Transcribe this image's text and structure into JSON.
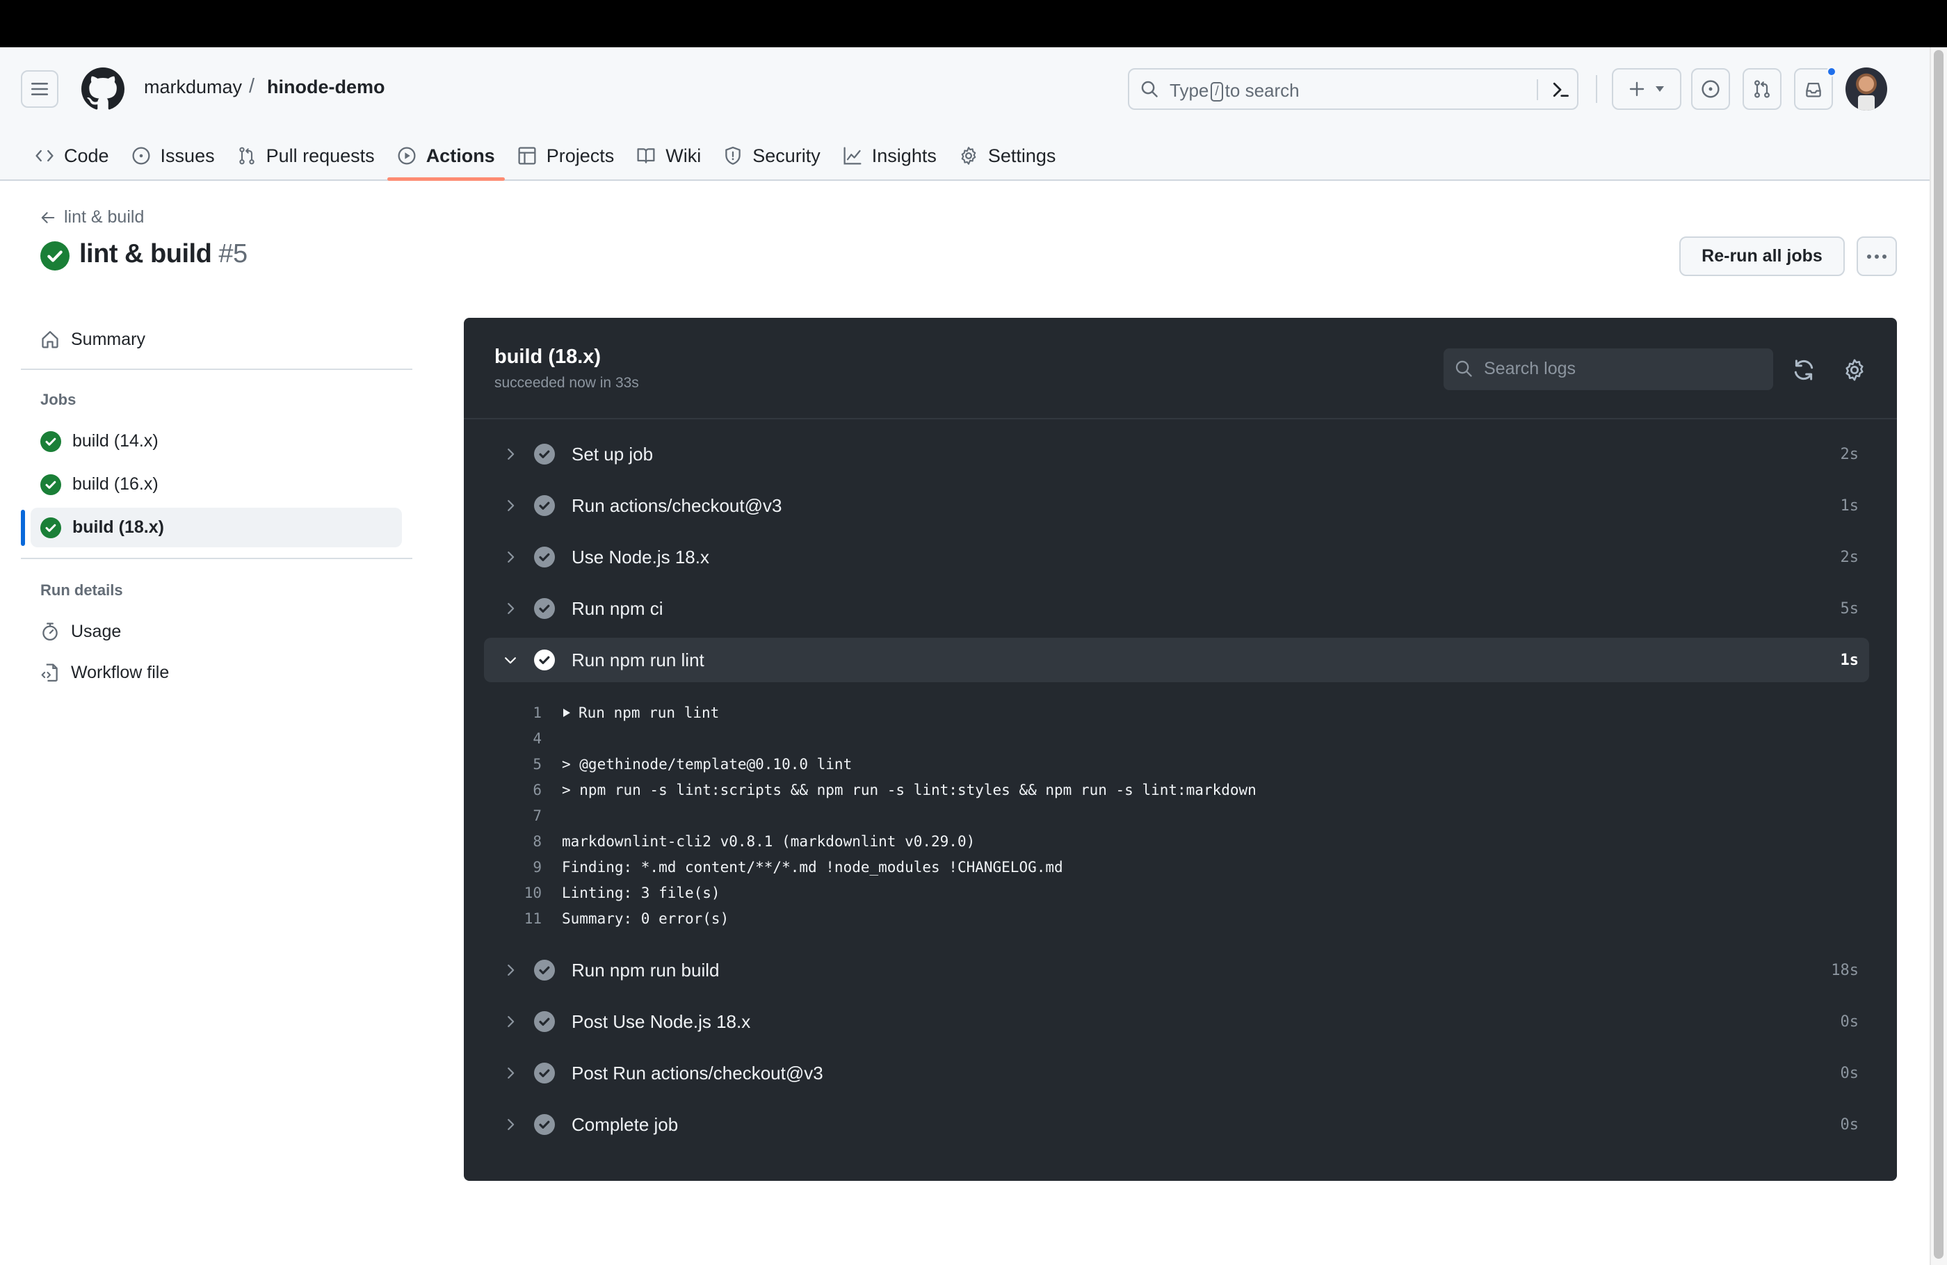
{
  "header": {
    "owner": "markdumay",
    "separator": "/",
    "repo": "hinode-demo",
    "search_prefix": "Type",
    "search_key": "/",
    "search_suffix": "to search",
    "icons": [
      "hamburger-menu-icon",
      "github-logo-icon",
      "search-icon",
      "command-palette-icon",
      "plus-icon",
      "caret-down-icon",
      "issue-opened-icon",
      "git-pull-request-icon",
      "inbox-icon"
    ],
    "notification_dot_color": "#1f6feb"
  },
  "tabs": [
    {
      "label": "Code",
      "icon": "code-icon",
      "active": false
    },
    {
      "label": "Issues",
      "icon": "issue-opened-icon",
      "active": false
    },
    {
      "label": "Pull requests",
      "icon": "git-pull-request-icon",
      "active": false
    },
    {
      "label": "Actions",
      "icon": "play-icon",
      "active": true
    },
    {
      "label": "Projects",
      "icon": "table-icon",
      "active": false
    },
    {
      "label": "Wiki",
      "icon": "book-icon",
      "active": false
    },
    {
      "label": "Security",
      "icon": "shield-icon",
      "active": false
    },
    {
      "label": "Insights",
      "icon": "graph-icon",
      "active": false
    },
    {
      "label": "Settings",
      "icon": "gear-icon",
      "active": false
    }
  ],
  "run": {
    "back_label": "lint & build",
    "title": "lint & build",
    "number": "#5",
    "status": "success",
    "rerun_label": "Re-run all jobs",
    "more_label": "..."
  },
  "sidebar": {
    "summary_label": "Summary",
    "jobs_heading": "Jobs",
    "jobs": [
      {
        "label": "build (14.x)",
        "status": "success",
        "selected": false
      },
      {
        "label": "build (16.x)",
        "status": "success",
        "selected": false
      },
      {
        "label": "build (18.x)",
        "status": "success",
        "selected": true
      }
    ],
    "run_details_heading": "Run details",
    "usage_label": "Usage",
    "workflow_file_label": "Workflow file"
  },
  "job": {
    "title": "build (18.x)",
    "subtitle": "succeeded now in 33s",
    "search_placeholder": "Search logs",
    "steps": [
      {
        "name": "Set up job",
        "duration": "2s",
        "expanded": false
      },
      {
        "name": "Run actions/checkout@v3",
        "duration": "1s",
        "expanded": false
      },
      {
        "name": "Use Node.js 18.x",
        "duration": "2s",
        "expanded": false
      },
      {
        "name": "Run npm ci",
        "duration": "5s",
        "expanded": false
      },
      {
        "name": "Run npm run lint",
        "duration": "1s",
        "expanded": true
      },
      {
        "name": "Run npm run build",
        "duration": "18s",
        "expanded": false
      },
      {
        "name": "Post Use Node.js 18.x",
        "duration": "0s",
        "expanded": false
      },
      {
        "name": "Post Run actions/checkout@v3",
        "duration": "0s",
        "expanded": false
      },
      {
        "name": "Complete job",
        "duration": "0s",
        "expanded": false
      }
    ],
    "log_lines": [
      {
        "n": "1",
        "text": "Run npm run lint",
        "collapsible": true
      },
      {
        "n": "4",
        "text": ""
      },
      {
        "n": "5",
        "text": "> @gethinode/template@0.10.0 lint"
      },
      {
        "n": "6",
        "text": "> npm run -s lint:scripts && npm run -s lint:styles && npm run -s lint:markdown"
      },
      {
        "n": "7",
        "text": ""
      },
      {
        "n": "8",
        "text": "markdownlint-cli2 v0.8.1 (markdownlint v0.29.0)"
      },
      {
        "n": "9",
        "text": "Finding: *.md content/**/*.md !node_modules !CHANGELOG.md"
      },
      {
        "n": "10",
        "text": "Linting: 3 file(s)"
      },
      {
        "n": "11",
        "text": "Summary: 0 error(s)"
      }
    ]
  },
  "colors": {
    "success": "#1a7f37",
    "active_tab_underline": "#fd8c73",
    "selected_job_bar": "#0969da",
    "log_panel_bg": "#24292f"
  }
}
